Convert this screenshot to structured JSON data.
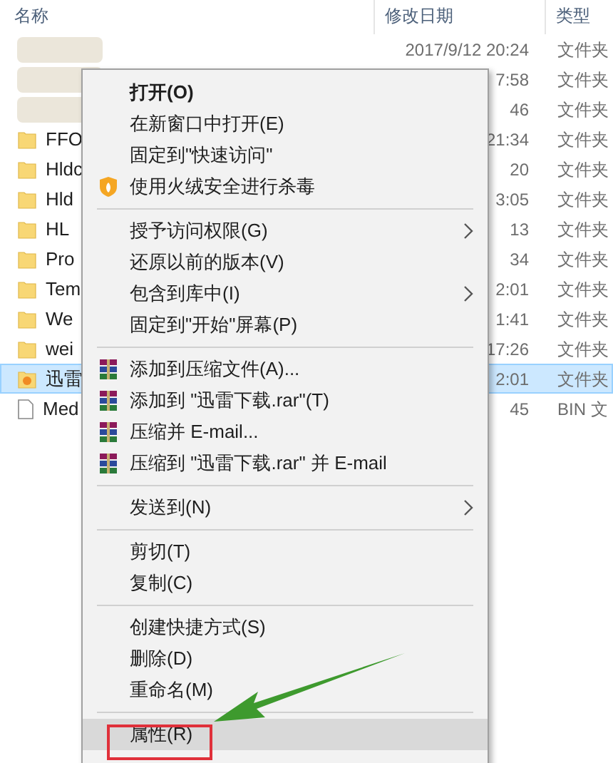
{
  "columns": [
    {
      "label": "名称"
    },
    {
      "label": "修改日期"
    },
    {
      "label": "类型"
    }
  ],
  "files": [
    {
      "kind": "blurred",
      "date": "2017/9/12 20:24",
      "type": "文件夹",
      "selected": false
    },
    {
      "kind": "blurred",
      "date": "7:58",
      "type": "文件夹",
      "selected": false
    },
    {
      "kind": "blurred",
      "date": "46",
      "type": "文件夹",
      "selected": false
    },
    {
      "kind": "folder",
      "name": "FFO",
      "date": "21:34",
      "type": "文件夹",
      "selected": false
    },
    {
      "kind": "folder",
      "name": "Hldc",
      "date": "20",
      "type": "文件夹",
      "selected": false
    },
    {
      "kind": "folder",
      "name": "Hld",
      "date": "3:05",
      "type": "文件夹",
      "selected": false
    },
    {
      "kind": "folder",
      "name": "HL",
      "date": "13",
      "type": "文件夹",
      "selected": false
    },
    {
      "kind": "folder",
      "name": "Pro",
      "date": "34",
      "type": "文件夹",
      "selected": false
    },
    {
      "kind": "folder",
      "name": "Tem",
      "date": "2:01",
      "type": "文件夹",
      "selected": false
    },
    {
      "kind": "folder",
      "name": "We",
      "date": "1:41",
      "type": "文件夹",
      "selected": false
    },
    {
      "kind": "folder",
      "name": "wei",
      "date": "17:26",
      "type": "文件夹",
      "selected": false
    },
    {
      "kind": "app-folder",
      "name": "迅雷",
      "date": "2:01",
      "type": "文件夹",
      "selected": true
    },
    {
      "kind": "file",
      "name": "Med",
      "date": "45",
      "type": "BIN 文",
      "selected": false
    }
  ],
  "menu": [
    {
      "kind": "item",
      "label": "打开(O)",
      "bold": true,
      "submenu": false,
      "selected": false
    },
    {
      "kind": "item",
      "label": "在新窗口中打开(E)",
      "bold": false,
      "submenu": false,
      "selected": false
    },
    {
      "kind": "item",
      "label": "固定到\"快速访问\"",
      "bold": false,
      "submenu": false,
      "selected": false
    },
    {
      "kind": "shield-item",
      "label": "使用火绒安全进行杀毒",
      "bold": false,
      "submenu": false,
      "selected": false
    },
    {
      "kind": "separator"
    },
    {
      "kind": "item",
      "label": "授予访问权限(G)",
      "bold": false,
      "submenu": true,
      "selected": false
    },
    {
      "kind": "item",
      "label": "还原以前的版本(V)",
      "bold": false,
      "submenu": false,
      "selected": false
    },
    {
      "kind": "item",
      "label": "包含到库中(I)",
      "bold": false,
      "submenu": true,
      "selected": false
    },
    {
      "kind": "item",
      "label": "固定到\"开始\"屏幕(P)",
      "bold": false,
      "submenu": false,
      "selected": false
    },
    {
      "kind": "separator"
    },
    {
      "kind": "archive-item",
      "label": "添加到压缩文件(A)...",
      "bold": false,
      "submenu": false,
      "selected": false
    },
    {
      "kind": "archive-item",
      "label": "添加到 \"迅雷下载.rar\"(T)",
      "bold": false,
      "submenu": false,
      "selected": false
    },
    {
      "kind": "archive-item",
      "label": "压缩并 E-mail...",
      "bold": false,
      "submenu": false,
      "selected": false
    },
    {
      "kind": "archive-item",
      "label": "压缩到 \"迅雷下载.rar\" 并 E-mail",
      "bold": false,
      "submenu": false,
      "selected": false
    },
    {
      "kind": "separator"
    },
    {
      "kind": "item",
      "label": "发送到(N)",
      "bold": false,
      "submenu": true,
      "selected": false
    },
    {
      "kind": "separator"
    },
    {
      "kind": "item",
      "label": "剪切(T)",
      "bold": false,
      "submenu": false,
      "selected": false
    },
    {
      "kind": "item",
      "label": "复制(C)",
      "bold": false,
      "submenu": false,
      "selected": false
    },
    {
      "kind": "separator"
    },
    {
      "kind": "item",
      "label": "创建快捷方式(S)",
      "bold": false,
      "submenu": false,
      "selected": false
    },
    {
      "kind": "item",
      "label": "删除(D)",
      "bold": false,
      "submenu": false,
      "selected": false
    },
    {
      "kind": "item",
      "label": "重命名(M)",
      "bold": false,
      "submenu": false,
      "selected": false
    },
    {
      "kind": "separator"
    },
    {
      "kind": "item",
      "label": "属性(R)",
      "bold": false,
      "submenu": false,
      "selected": true
    }
  ]
}
